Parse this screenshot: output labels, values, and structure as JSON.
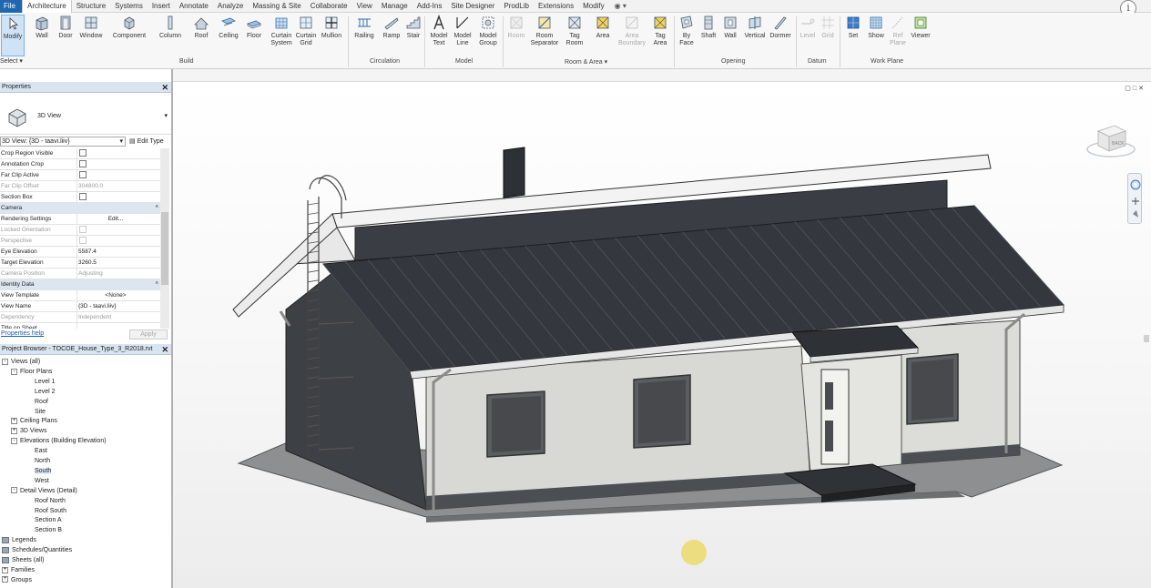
{
  "menu": {
    "tabs": [
      "File",
      "Architecture",
      "Structure",
      "Systems",
      "Insert",
      "Annotate",
      "Analyze",
      "Massing & Site",
      "Collaborate",
      "View",
      "Manage",
      "Add-Ins",
      "Site Designer",
      "ProdLib",
      "Extensions",
      "Modify"
    ],
    "active_tab": "Architecture",
    "info": "i"
  },
  "ribbon": {
    "select_label": "Select",
    "modify": "Modify",
    "buttons": {
      "wall": "Wall",
      "door": "Door",
      "window": "Window",
      "component": "Component",
      "column": "Column",
      "roof": "Roof",
      "ceiling": "Ceiling",
      "floor": "Floor",
      "curtain_system": "Curtain System",
      "curtain_grid": "Curtain Grid",
      "mullion": "Mullion",
      "railing": "Railing",
      "ramp": "Ramp",
      "stair": "Stair",
      "model_text": "Model Text",
      "model_line": "Model Line",
      "model_group": "Model Group",
      "room": "Room",
      "room_separator": "Room Separator",
      "tag_room": "Tag Room",
      "area": "Area",
      "area_boundary": "Area Boundary",
      "tag_area": "Tag Area",
      "by_face": "By Face",
      "shaft": "Shaft",
      "wall2": "Wall",
      "vertical": "Vertical",
      "dormer": "Dormer",
      "level": "Level",
      "grid": "Grid",
      "set": "Set",
      "show": "Show",
      "ref_plane": "Ref Plane",
      "viewer": "Viewer"
    },
    "groups": {
      "build": "Build",
      "circulation": "Circulation",
      "model": "Model",
      "room_area": "Room & Area",
      "opening": "Opening",
      "datum": "Datum",
      "work_plane": "Work Plane"
    }
  },
  "properties": {
    "title": "Properties",
    "type_name": "3D View",
    "instance_selector": "3D View: {3D - taavi.liiv}",
    "edit_type": "Edit Type",
    "rows": [
      {
        "key": "Crop Region Visible",
        "kind": "check"
      },
      {
        "key": "Annotation Crop",
        "kind": "check"
      },
      {
        "key": "Far Clip Active",
        "kind": "check"
      },
      {
        "key": "Far Clip Offset",
        "value": "304800.0",
        "kind": "dim"
      },
      {
        "key": "Section Box",
        "kind": "check"
      },
      {
        "key": "Camera",
        "kind": "section"
      },
      {
        "key": "Rendering Settings",
        "value": "Edit...",
        "kind": "center"
      },
      {
        "key": "Locked Orientation",
        "kind": "dimcheck"
      },
      {
        "key": "Perspective",
        "kind": "dimcheck"
      },
      {
        "key": "Eye Elevation",
        "value": "5587.4",
        "kind": "val"
      },
      {
        "key": "Target Elevation",
        "value": "3260.5",
        "kind": "val"
      },
      {
        "key": "Camera Position",
        "value": "Adjusting",
        "kind": "dim"
      },
      {
        "key": "Identity Data",
        "kind": "section"
      },
      {
        "key": "View Template",
        "value": "<None>",
        "kind": "center"
      },
      {
        "key": "View Name",
        "value": "{3D - taavi.liiv}",
        "kind": "val"
      },
      {
        "key": "Dependency",
        "value": "Independent",
        "kind": "dim"
      },
      {
        "key": "Title on Sheet",
        "value": "",
        "kind": "val"
      }
    ],
    "help": "Properties help",
    "apply": "Apply"
  },
  "browser": {
    "title": "Project Browser - TOCOE_House_Type_3_R2018.rvt",
    "nodes": [
      {
        "label": "Views (all)",
        "level": 0,
        "toggle": "-"
      },
      {
        "label": "Floor Plans",
        "level": 1,
        "toggle": "-"
      },
      {
        "label": "Level 1",
        "level": 2
      },
      {
        "label": "Level 2",
        "level": 2
      },
      {
        "label": "Roof",
        "level": 2
      },
      {
        "label": "Site",
        "level": 2
      },
      {
        "label": "Ceiling Plans",
        "level": 1,
        "toggle": "+"
      },
      {
        "label": "3D Views",
        "level": 1,
        "toggle": "+"
      },
      {
        "label": "Elevations (Building Elevation)",
        "level": 1,
        "toggle": "-"
      },
      {
        "label": "East",
        "level": 2
      },
      {
        "label": "North",
        "level": 2
      },
      {
        "label": "South",
        "level": 2,
        "selected": true
      },
      {
        "label": "West",
        "level": 2
      },
      {
        "label": "Detail Views (Detail)",
        "level": 1,
        "toggle": "-"
      },
      {
        "label": "Roof North",
        "level": 2
      },
      {
        "label": "Roof South",
        "level": 2
      },
      {
        "label": "Section A",
        "level": 2
      },
      {
        "label": "Section B",
        "level": 2
      },
      {
        "label": "Legends",
        "level": 0,
        "icon": true
      },
      {
        "label": "Schedules/Quantities",
        "level": 0,
        "icon": true
      },
      {
        "label": "Sheets (all)",
        "level": 0,
        "icon": true
      },
      {
        "label": "Families",
        "level": 0,
        "toggle": "+"
      },
      {
        "label": "Groups",
        "level": 0,
        "toggle": "+"
      }
    ]
  },
  "viewport": {
    "viewcube_face": "BACK"
  },
  "colors": {
    "accent": "#1f67b1",
    "roof": "#2e3237",
    "wall": "#d9d9d6",
    "dark_wall": "#3a3d42"
  }
}
